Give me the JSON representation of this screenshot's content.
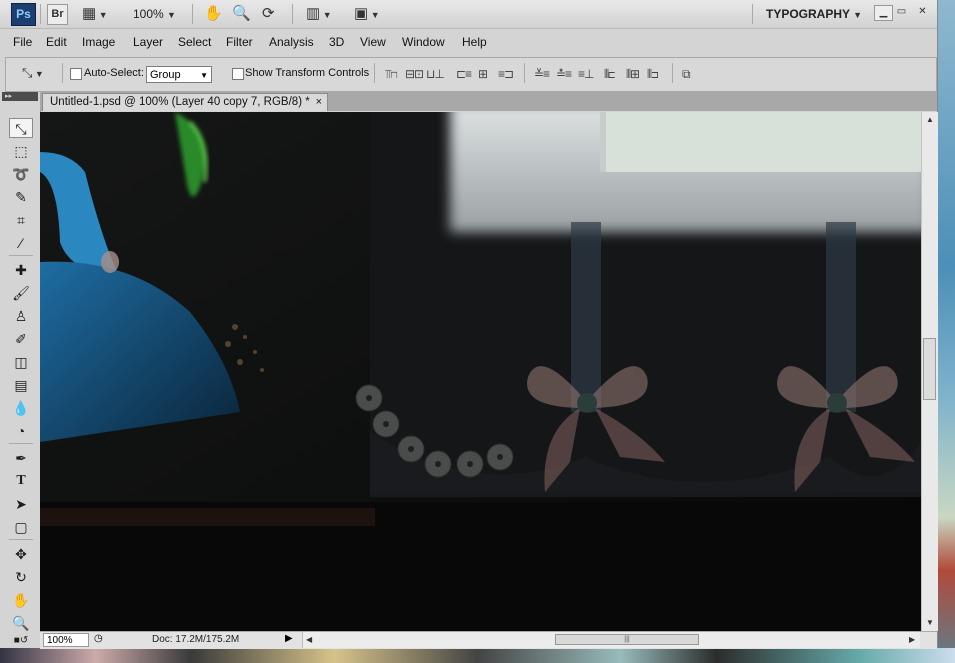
{
  "app": {
    "logo": "Ps",
    "bridge_label": "Br",
    "zoom_level": "100%",
    "workspace": "TYPOGRAPHY"
  },
  "menu": [
    "File",
    "Edit",
    "Image",
    "Layer",
    "Select",
    "Filter",
    "Analysis",
    "3D",
    "View",
    "Window",
    "Help"
  ],
  "options": {
    "auto_select_label": "Auto-Select:",
    "auto_select_checked": false,
    "auto_select_value": "Group",
    "show_transform_label": "Show Transform Controls",
    "show_transform_checked": false
  },
  "document": {
    "tab_title": "Untitled-1.psd @ 100% (Layer 40 copy 7, RGB/8) *",
    "close_glyph": "×"
  },
  "status": {
    "zoom": "100%",
    "doc_size": "Doc: 17.2M/175.2M"
  },
  "icons": {
    "minimize": "minimize-icon",
    "restore": "restore-icon",
    "close": "close-icon"
  }
}
